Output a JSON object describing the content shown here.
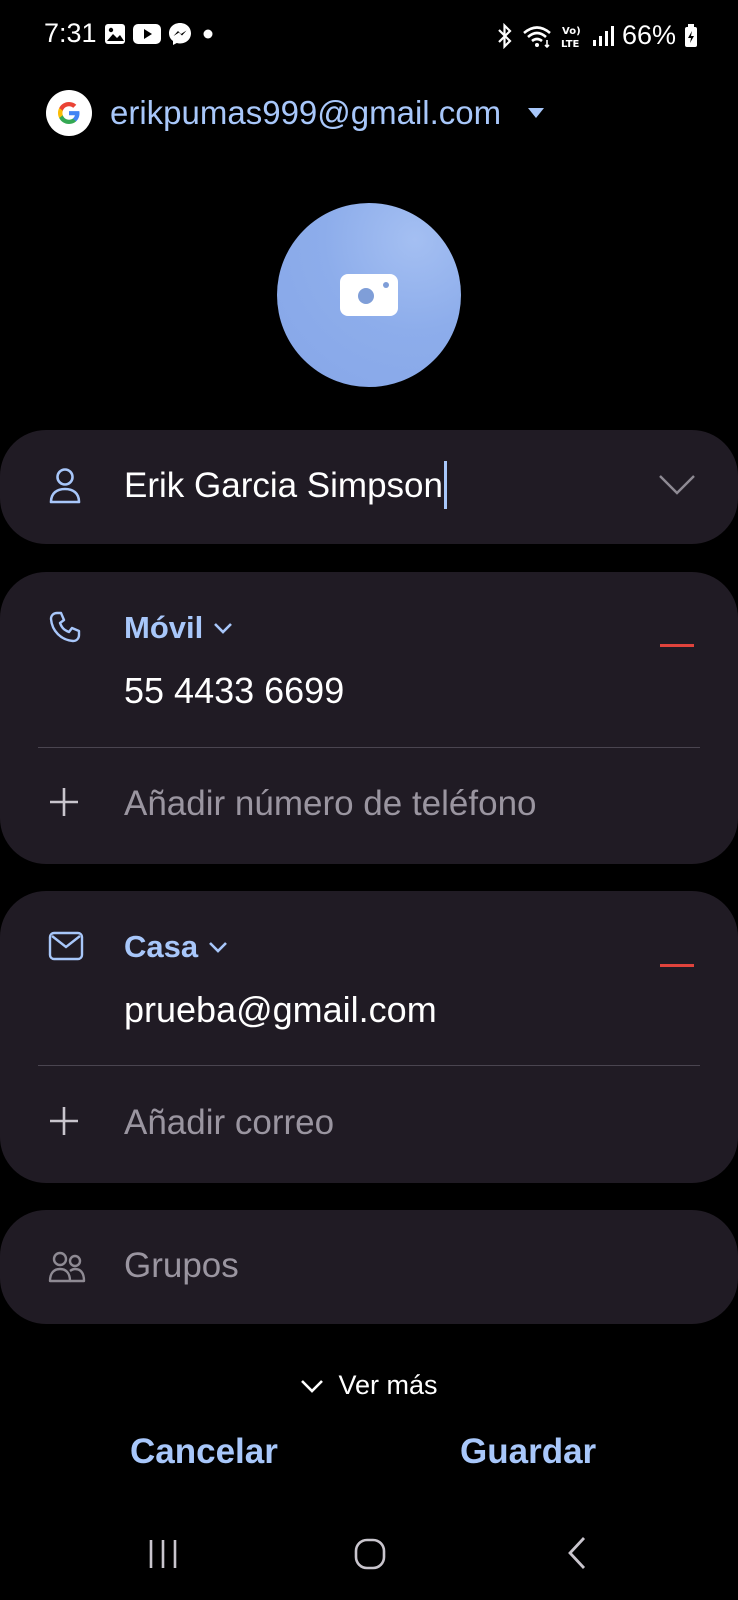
{
  "status_bar": {
    "time": "7:31",
    "battery": "66%",
    "left_icons": [
      "gallery-icon",
      "youtube-icon",
      "messenger-icon",
      "dot-icon"
    ],
    "right_icons": [
      "bluetooth-icon",
      "wifi-icon",
      "volte-icon",
      "signal-icon",
      "battery-icon"
    ]
  },
  "account": {
    "email": "erikpumas999@gmail.com",
    "icon": "google-icon"
  },
  "avatar": {
    "icon": "camera-icon",
    "color": "#8dadeb"
  },
  "name_field": {
    "value": "Erik Garcia Simpson",
    "icon": "person-icon"
  },
  "phone_section": {
    "type_label": "Móvil",
    "value": "55 4433 6699",
    "add_label": "Añadir número de teléfono",
    "icon": "phone-icon"
  },
  "email_section": {
    "type_label": "Casa",
    "value": "prueba@gmail.com",
    "add_label": "Añadir correo",
    "icon": "mail-icon"
  },
  "groups": {
    "label": "Grupos",
    "icon": "groups-icon"
  },
  "more": {
    "label": "Ver más"
  },
  "actions": {
    "cancel": "Cancelar",
    "save": "Guardar"
  },
  "colors": {
    "accent": "#a8c7fa",
    "card": "#201b24",
    "remove": "#e0433c",
    "background": "#000000"
  }
}
